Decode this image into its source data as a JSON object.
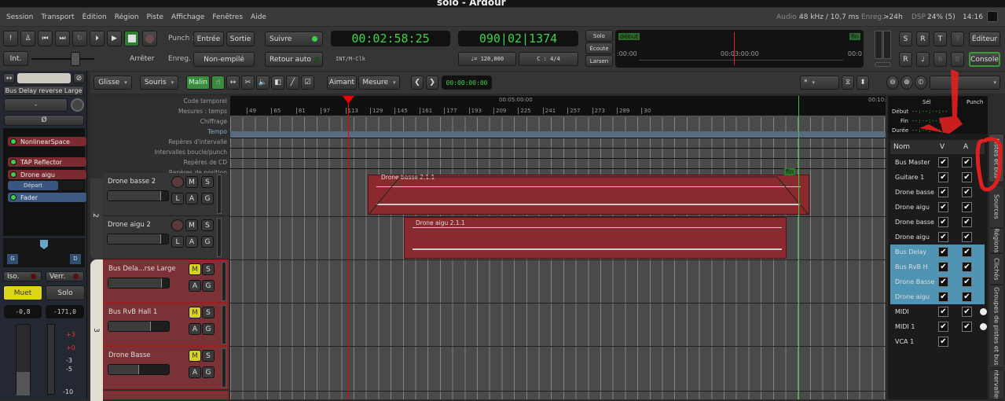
{
  "window": {
    "title": "solo - Ardour"
  },
  "menu": [
    "Session",
    "Transport",
    "Édition",
    "Région",
    "Piste",
    "Affichage",
    "Fenêtres",
    "Aide"
  ],
  "status": {
    "audio_label": "Audio :",
    "audio": "48 kHz / 10,7 ms",
    "rec_label": "Enreg. :",
    "rec": ">24h",
    "dsp_label": "DSP :",
    "dsp": "24% (5)",
    "time": "14:16"
  },
  "transport": {
    "punch_label": "Punch :",
    "in": "Entrée",
    "out": "Sortie",
    "rec_label": "Enreg. :",
    "rec_mode": "Non-empilé",
    "follow": "Suivre",
    "auto_return": "Retour auto",
    "int": "Int.",
    "stop": "Arrêter",
    "clock1": "00:02:58:25",
    "clock1_sub": "INT/M-Clk",
    "clock2": "090|02|1374",
    "tempo": "♩= 120,000",
    "meter": "C : 4/4",
    "solo": "Solo",
    "listen": "Écoute",
    "feedback": "Larsen",
    "mini_start": "début",
    "mini_end": "fin",
    "mini_t0": ":00:00",
    "mini_t1": "00:03:00:00",
    "mini_t2": "00:0",
    "btns": [
      "S",
      "R",
      "T",
      "7",
      "R",
      "♩",
      "6",
      "8"
    ],
    "editor": "Éditeur",
    "mixer": "Console"
  },
  "edit_toolbar": {
    "mode": "Glisse",
    "mouse": "Souris",
    "smart": "Malin",
    "snap": "Aimant",
    "grid": "Mesure",
    "nudge_clock": "00:00:00:00",
    "zoom_focus": "*"
  },
  "strip": {
    "name": "Bus Delay reverse Large",
    "input": "-",
    "phase": "Ø",
    "plugins": [
      "NonlinearSpace",
      "TAP Reflector",
      "Drone aigu"
    ],
    "send": "Départ",
    "fader": "Fader",
    "pan_l": "G",
    "pan_r": "D",
    "iso": "Iso.",
    "lock": "Verr.",
    "mute": "Muet",
    "solo": "Solo",
    "gain": "-0,8",
    "peak": "-171,0",
    "meter_ticks": [
      "+3",
      "+0",
      "-3",
      "-5",
      "-10"
    ]
  },
  "rulers": [
    "Code temporel",
    "Mesures : temps",
    "Chiffrage",
    "Tempo",
    "Repères d'intervalle",
    "Intervalles boucle/punch",
    "Repères de CD",
    "Repères de position"
  ],
  "ruler_time": [
    "00:05:00:00",
    "00:10:0"
  ],
  "ruler_bars": [
    "49",
    "65",
    "81",
    "97",
    "113",
    "129",
    "145",
    "161",
    "177",
    "193",
    "209",
    "225",
    "241",
    "257",
    "273",
    "289",
    "30"
  ],
  "end_marker": "fin",
  "groups": [
    "2",
    "3"
  ],
  "tracks": [
    {
      "name": "Drone basse 2",
      "buttons": [
        "M",
        "S",
        "L",
        "A",
        "G"
      ],
      "region": "Drone basse 2.1.1"
    },
    {
      "name": "Drone aigu 2",
      "buttons": [
        "M",
        "S",
        "L",
        "A",
        "G"
      ],
      "region": "Drone aigu 2.1.1"
    },
    {
      "name": "Bus Dela...rse Large",
      "buttons": [
        "M",
        "S",
        "A",
        "G"
      ]
    },
    {
      "name": "Bus  RvB Hall 1",
      "buttons": [
        "M",
        "S",
        "A",
        "G"
      ]
    },
    {
      "name": "Drone Basse",
      "buttons": [
        "M",
        "S",
        "A",
        "G"
      ]
    }
  ],
  "right": {
    "sel": "Sél",
    "punch": "Punch",
    "start": "Début",
    "end": "Fin",
    "dur": "Durée",
    "clock": "--:--:--:--",
    "col_name": "Nom",
    "col_v": "V",
    "col_a": "A",
    "rows": [
      {
        "n": "Bus Master",
        "a": true
      },
      {
        "n": "Guitare 1",
        "a": true
      },
      {
        "n": "Drone basse",
        "a": true
      },
      {
        "n": "Drone aigu",
        "a": true
      },
      {
        "n": "Drone basse",
        "a": true
      },
      {
        "n": "Drone aigu",
        "a": true
      },
      {
        "n": "Bus Delay",
        "a": true,
        "sel": true
      },
      {
        "n": "Bus  RvB H",
        "a": true,
        "sel": true
      },
      {
        "n": "Drone Basse",
        "a": true,
        "sel": true
      },
      {
        "n": "Drone aigu",
        "a": true,
        "sel": true
      },
      {
        "n": "MIDI",
        "a": true
      },
      {
        "n": "MIDI 1",
        "a": true
      },
      {
        "n": "VCA 1",
        "a": false
      }
    ],
    "tabs": [
      "Pistes et bus",
      "Sources",
      "Régions",
      "Clichés",
      "Groupes de pistes et bus",
      "Intervalles"
    ]
  },
  "colors": {
    "clock": "#3fd14b",
    "region": "#8a2a2e",
    "selected": "#4f94b2",
    "mute": "#d8d21a",
    "annotation": "#e02020"
  }
}
